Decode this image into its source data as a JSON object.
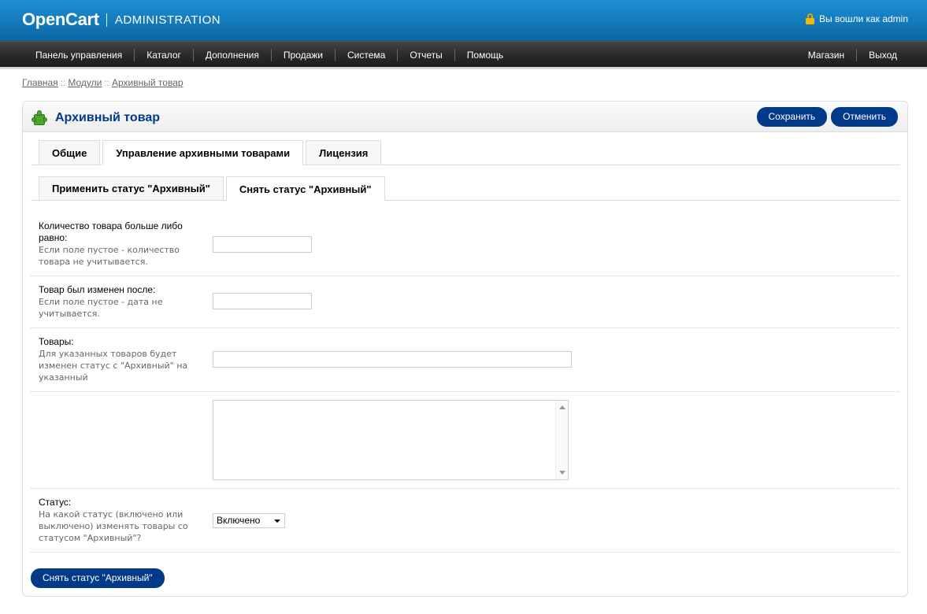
{
  "header": {
    "logo": "OpenCart",
    "section": "ADMINISTRATION",
    "login_text": "Вы вошли как admin",
    "lock_icon": "lock-icon"
  },
  "menu": {
    "left": [
      "Панель управления",
      "Каталог",
      "Дополнения",
      "Продажи",
      "Система",
      "Отчеты",
      "Помощь"
    ],
    "right": [
      "Магазин",
      "Выход"
    ]
  },
  "breadcrumb": [
    "Главная",
    "Модули",
    "Архивный товар"
  ],
  "breadcrumb_sep": "::",
  "box": {
    "title": "Архивный товар",
    "icon": "puzzle-icon",
    "save_label": "Сохранить",
    "cancel_label": "Отменить"
  },
  "tabs": {
    "main": [
      "Общие",
      "Управление архивными товарами",
      "Лицензия"
    ],
    "main_active": 1,
    "sub": [
      "Применить статус \"Архивный\"",
      "Снять статус \"Архивный\""
    ],
    "sub_active": 1
  },
  "form": {
    "quantity": {
      "label": "Количество товара больше либо равно:",
      "help": "Если поле пустое - количество товара не учитывается.",
      "value": ""
    },
    "modified": {
      "label": "Товар был изменен после:",
      "help": "Если поле пустое - дата не учитывается.",
      "value": ""
    },
    "products": {
      "label": "Товары:",
      "help": "Для указанных товаров будет изменен статус с \"Архивный\" на указанный",
      "value": ""
    },
    "products_list": {
      "value": ""
    },
    "status": {
      "label": "Статус:",
      "help": "На какой статус (включено или выключено) изменять товары со статусом \"Архивный\"?",
      "selected": "Включено"
    },
    "submit_label": "Снять статус \"Архивный\""
  },
  "colors": {
    "header_blue": "#1278b9",
    "button_navy": "#003a88",
    "title_navy": "#003a88",
    "menu_dark": "#2b2b2b",
    "icon_green": "#4ca52d"
  }
}
